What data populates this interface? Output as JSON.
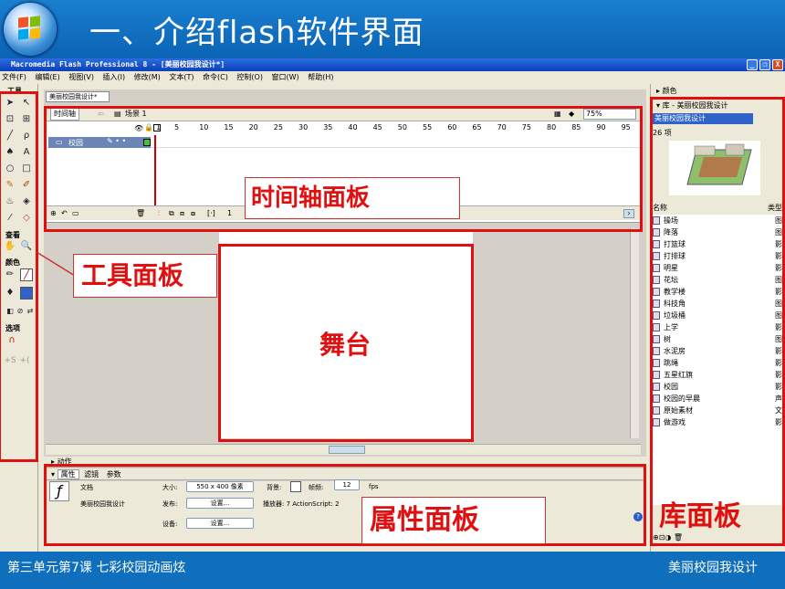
{
  "slide": {
    "title": "一、介绍flash软件界面",
    "footer_left": "第三单元第7课  七彩校园动画炫",
    "footer_right": "美丽校园我设计"
  },
  "window": {
    "title": "Macromedia Flash Professional 8 - [美丽校园我设计*]",
    "controls": [
      "_",
      "❐",
      "X"
    ]
  },
  "menu": [
    "文件(F)",
    "编辑(E)",
    "视图(V)",
    "插入(I)",
    "修改(M)",
    "文本(T)",
    "命令(C)",
    "控制(O)",
    "窗口(W)",
    "帮助(H)"
  ],
  "tools": {
    "header": "工具",
    "view_label": "查看",
    "color_label": "颜色",
    "options_label": "选项",
    "icons": [
      "arrow-icon",
      "subselect-icon",
      "free-transform-icon",
      "fill-transform-icon",
      "line-icon",
      "lasso-icon",
      "pen-icon",
      "text-icon",
      "oval-icon",
      "rectangle-icon",
      "pencil-icon",
      "brush-icon",
      "ink-bottle-icon",
      "paint-bucket-icon",
      "eyedropper-icon",
      "eraser-icon"
    ]
  },
  "document": {
    "tab": "美丽校园我设计*",
    "timeline_label": "时间轴",
    "scene": "场景 1",
    "zoom": "75%",
    "frame_numbers": [
      "1",
      "5",
      "10",
      "15",
      "20",
      "25",
      "30",
      "35",
      "40",
      "45",
      "50",
      "55",
      "60",
      "65",
      "70",
      "75",
      "80",
      "85",
      "90",
      "95"
    ],
    "layer_name": "校园",
    "current_frame": "1"
  },
  "panels": {
    "actions": "动作",
    "props_tabs": [
      "属性",
      "滤镜",
      "参数"
    ],
    "doc_label": "文档",
    "doc_name": "美丽校园我设计",
    "size_label": "大小:",
    "size_value": "550 x 400 像素",
    "bg_label": "背景:",
    "fps_label": "帧频:",
    "fps_value": "12",
    "fps_unit": "fps",
    "publish_label": "发布:",
    "settings_btn": "设置...",
    "player_text": "播放器: 7   ActionScript: 2",
    "device_label": "设备:",
    "device_btn": "设置..."
  },
  "library": {
    "color_panel": "颜色",
    "title": "库 - 美丽校园我设计",
    "dropdown": "美丽校园我设计",
    "count": "26 项",
    "col_name": "名称",
    "col_type": "类型",
    "items": [
      {
        "name": "操场",
        "type": "图"
      },
      {
        "name": "降落",
        "type": "图"
      },
      {
        "name": "打篮球",
        "type": "影"
      },
      {
        "name": "打排球",
        "type": "影"
      },
      {
        "name": "明星",
        "type": "影"
      },
      {
        "name": "花坛",
        "type": "图"
      },
      {
        "name": "教学楼",
        "type": "影"
      },
      {
        "name": "科技角",
        "type": "图"
      },
      {
        "name": "垃圾桶",
        "type": "图"
      },
      {
        "name": "上学",
        "type": "影"
      },
      {
        "name": "树",
        "type": "图"
      },
      {
        "name": "水泥房",
        "type": "影"
      },
      {
        "name": "跳绳",
        "type": "影"
      },
      {
        "name": "五星红旗",
        "type": "影"
      },
      {
        "name": "校园",
        "type": "影"
      },
      {
        "name": "校园的早晨",
        "type": "声"
      },
      {
        "name": "原始素材",
        "type": "文"
      },
      {
        "name": "做游戏",
        "type": "影"
      }
    ]
  },
  "callouts": {
    "timeline": "时间轴面板",
    "tools": "工具面板",
    "stage": "舞台",
    "properties": "属性面板",
    "library": "库面板"
  },
  "colors": {
    "annotation": "#e01010",
    "slide_bg": "#0f6fbd"
  }
}
